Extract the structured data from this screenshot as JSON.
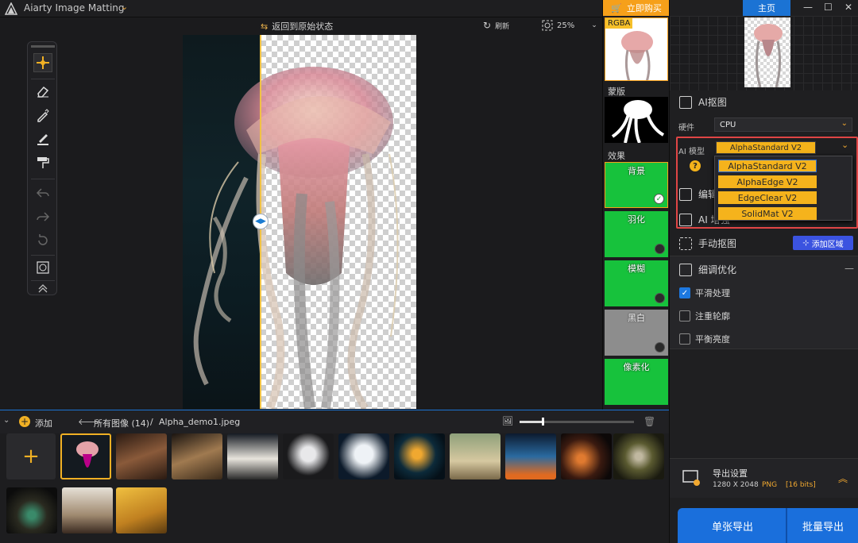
{
  "titlebar": {
    "app_title": "Aiarty Image Matting",
    "caret": "⌄"
  },
  "canvasbar": {
    "back_to_original": "返回到原始状态",
    "refresh": "刷新",
    "zoom": "25%"
  },
  "strip": {
    "buy_label": "立即购买",
    "rgba_label": "RGBA",
    "mask_label": "蒙版",
    "effects_label": "效果",
    "effects": [
      {
        "label": "背景",
        "checked": true
      },
      {
        "label": "羽化",
        "checked": false
      },
      {
        "label": "模糊",
        "checked": false
      },
      {
        "label": "黑白",
        "checked": false
      },
      {
        "label": "像素化",
        "checked": false
      }
    ]
  },
  "panel": {
    "home_tab": "主页",
    "ai_matting_title": "AI抠图",
    "hardware_label": "硬件",
    "hardware_value": "CPU",
    "model_label": "AI 模型",
    "model_value": "AlphaStandard  V2",
    "model_options": [
      "AlphaStandard  V2",
      "AlphaEdge   V2",
      "EdgeClear   V2",
      "SolidMat  V2"
    ],
    "help_glyph": "?",
    "edit_title": "编辑",
    "ai_title": "AI 增强",
    "manual_title": "手动抠图",
    "add_region": "添加区域",
    "fine_title": "细调优化",
    "options": [
      {
        "label": "平滑处理",
        "checked": true
      },
      {
        "label": "注重轮廓",
        "checked": false
      },
      {
        "label": "平衡亮度",
        "checked": false
      }
    ],
    "export_title": "导出设置",
    "export_size": "1280 X 2048",
    "export_format": "PNG",
    "export_bits": "[16 bits]",
    "single_export": "单张导出",
    "batch_export": "批量导出"
  },
  "bottombar": {
    "add_label": "添加",
    "all_images": "所有图像 (14)",
    "separator": "/",
    "current_file": "Alpha_demo1.jpeg",
    "thumb_size_level": 0.2
  },
  "colors": {
    "accent_orange": "#f6a01a",
    "accent_blue": "#1b73d4",
    "effect_green": "#17c23c",
    "highlight_red": "#e04545"
  }
}
